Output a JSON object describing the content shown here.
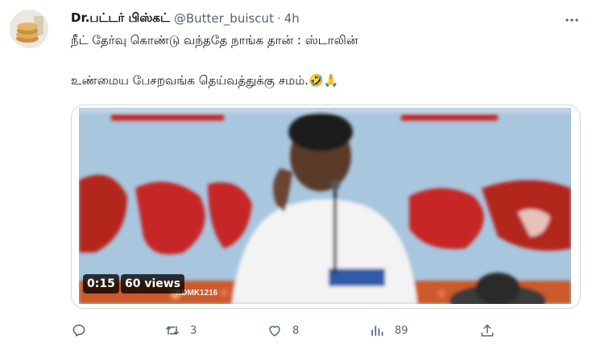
{
  "author": {
    "display_name": "Dr.பட்டர் பிஸ்கட்",
    "handle": "@Butter_buiscut",
    "separator": "·",
    "time": "4h"
  },
  "tweet": {
    "line1": "நீட் தேர்வு கொண்டு வந்ததே நாங்க தான் : ஸ்டாலின்",
    "line2": "உண்மைய பேசறவங்க தெய்வத்துக்கு சமம்.",
    "line2_emoji": "🤣🙏"
  },
  "media": {
    "duration": "0:15",
    "views": "60 views",
    "watermark": "ADMK1216"
  },
  "actions": {
    "reply_count": "",
    "retweet_count": "3",
    "like_count": "8",
    "views_count": "89"
  },
  "icons": [
    "more-icon",
    "reply-icon",
    "retweet-icon",
    "like-icon",
    "views-icon",
    "share-icon"
  ],
  "colors": {
    "text": "#0f1419",
    "secondary": "#536471",
    "border": "#cfd9de",
    "video_background": "#a9c6df",
    "banner_red": "#c62828"
  }
}
